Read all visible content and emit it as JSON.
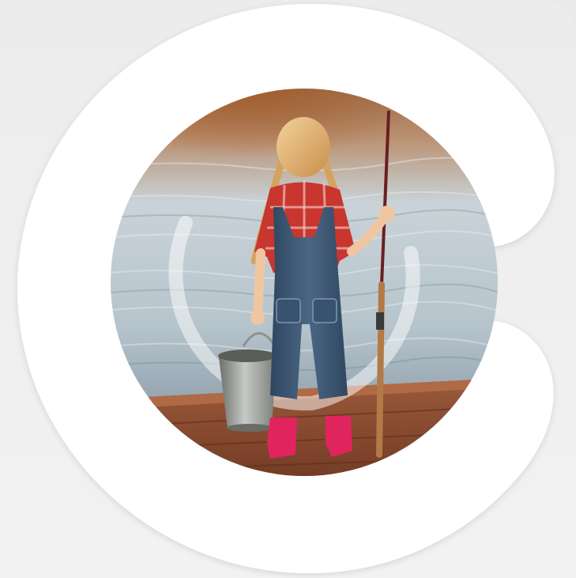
{
  "image": {
    "subject": "child-fishing-on-dock",
    "brand_mark_shape": "C-shaped logo ring",
    "colors": {
      "background": "#ececec",
      "logo_ring": "#ffffff",
      "water_light": "#b9c7cf",
      "water_dark": "#5e6f7b",
      "sunset_glow": "#b4683a",
      "dock_wood": "#8a4a30",
      "shirt_red": "#c8362f",
      "overalls_denim": "#3f5773",
      "boots_pink": "#e0245e",
      "hair_blonde": "#e9b56f",
      "bucket_metal": "#9ea3a2",
      "rod_cork": "#b27a45"
    }
  }
}
